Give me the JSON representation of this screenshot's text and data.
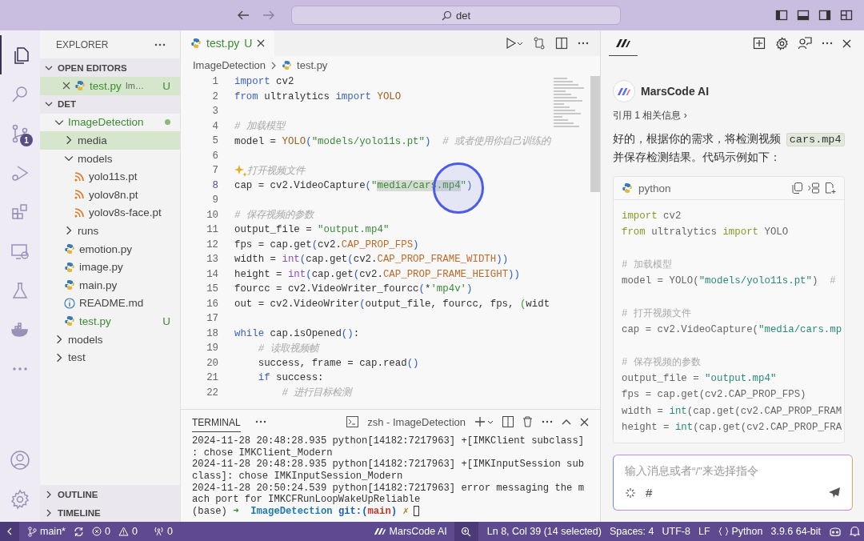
{
  "title_bar": {
    "search": "det"
  },
  "activity_bar": {
    "items": [
      {
        "kind": "files",
        "selected": true
      },
      {
        "kind": "search",
        "selected": false
      },
      {
        "kind": "source-control",
        "selected": false,
        "badge": "1"
      },
      {
        "kind": "debug",
        "selected": false
      },
      {
        "kind": "extensions",
        "selected": false
      },
      {
        "kind": "remote",
        "selected": false
      },
      {
        "kind": "testing",
        "selected": false
      },
      {
        "kind": "docker",
        "selected": false
      },
      {
        "kind": "more",
        "selected": false
      }
    ],
    "bottom": [
      {
        "kind": "account"
      },
      {
        "kind": "settings"
      }
    ]
  },
  "explorer": {
    "title": "EXPLORER",
    "open_editors": {
      "title": "OPEN EDITORS",
      "expanded": true,
      "items": [
        {
          "name": "test.py",
          "description": "Im…",
          "status": "U",
          "selected": true
        }
      ]
    },
    "folder": {
      "title": "DET",
      "expanded": true,
      "tree": [
        {
          "name": "ImageDetection",
          "kind": "folder",
          "expanded": true,
          "selected": false,
          "untracked": true,
          "children": [
            {
              "name": "media",
              "kind": "folder",
              "expanded": false,
              "selected": true,
              "untracked": false
            },
            {
              "name": "models",
              "kind": "folder",
              "expanded": true,
              "selected": false,
              "untracked": false,
              "children": [
                {
                  "name": "yolo11s.pt",
                  "kind": "model",
                  "selected": false,
                  "untracked": false
                },
                {
                  "name": "yolov8n.pt",
                  "kind": "model",
                  "selected": false,
                  "untracked": false
                },
                {
                  "name": "yolov8s-face.pt",
                  "kind": "model",
                  "selected": false,
                  "untracked": false
                }
              ]
            },
            {
              "name": "runs",
              "kind": "folder",
              "expanded": false,
              "selected": false,
              "untracked": false
            },
            {
              "name": "emotion.py",
              "kind": "python",
              "selected": false,
              "untracked": false
            },
            {
              "name": "image.py",
              "kind": "python",
              "selected": false,
              "untracked": false
            },
            {
              "name": "main.py",
              "kind": "python",
              "selected": false,
              "untracked": false
            },
            {
              "name": "README.md",
              "kind": "info",
              "selected": false,
              "untracked": false
            },
            {
              "name": "test.py",
              "kind": "python",
              "selected": false,
              "untracked": true,
              "status": "U"
            }
          ]
        },
        {
          "name": "models",
          "kind": "folder",
          "expanded": false,
          "selected": false,
          "untracked": false
        },
        {
          "name": "test",
          "kind": "folder",
          "expanded": false,
          "selected": false,
          "untracked": false
        }
      ]
    },
    "collapsed_sections": [
      {
        "title": "OUTLINE",
        "expanded": false
      },
      {
        "title": "TIMELINE",
        "expanded": false
      }
    ]
  },
  "editor": {
    "tabs": [
      {
        "label": "test.py",
        "status": "U",
        "selected": true
      }
    ],
    "breadcrumb": [
      "ImageDetection",
      "test.py"
    ],
    "lines": [
      {
        "number": "1",
        "current": false,
        "tokens": [
          {
            "text": "import",
            "kind": "kw"
          },
          {
            "text": " cv2",
            "kind": "plain"
          }
        ]
      },
      {
        "number": "2",
        "current": false,
        "tokens": [
          {
            "text": "from",
            "kind": "kw"
          },
          {
            "text": " ultralytics ",
            "kind": "plain"
          },
          {
            "text": "import",
            "kind": "kw"
          },
          {
            "text": " YOLO",
            "kind": "cls"
          }
        ]
      },
      {
        "number": "3",
        "current": false
      },
      {
        "number": "4",
        "current": false,
        "tokens": [
          {
            "text": "# 加载模型",
            "kind": "com"
          }
        ]
      },
      {
        "number": "5",
        "current": false,
        "tokens": [
          {
            "text": "model = ",
            "kind": "plain"
          },
          {
            "text": "YOLO",
            "kind": "cls"
          },
          {
            "text": "(",
            "kind": "punc"
          },
          {
            "text": "\"models/yolo11s.pt\"",
            "kind": "str"
          },
          {
            "text": ")",
            "kind": "punc"
          },
          {
            "text": "  # 或者使用你自己训练的",
            "kind": "com"
          }
        ]
      },
      {
        "number": "6",
        "current": false
      },
      {
        "number": "7",
        "current": false,
        "tokens": [
          {
            "kind": "sparkle"
          },
          {
            "text": "打开视频文件",
            "kind": "com"
          }
        ]
      },
      {
        "number": "8",
        "current": true,
        "tokens": [
          {
            "text": "cap = cv2.VideoCapture",
            "kind": "plain"
          },
          {
            "text": "(",
            "kind": "punc"
          },
          {
            "text": "\"",
            "kind": "str"
          },
          {
            "text": "media/cars.mp4",
            "kind": "sel"
          },
          {
            "text": "\"",
            "kind": "str"
          },
          {
            "text": ")",
            "kind": "punc"
          }
        ]
      },
      {
        "number": "9",
        "current": false
      },
      {
        "number": "10",
        "current": false,
        "tokens": [
          {
            "text": "# 保存视频的参数",
            "kind": "com"
          }
        ]
      },
      {
        "number": "11",
        "current": false,
        "tokens": [
          {
            "text": "output_file = ",
            "kind": "plain"
          },
          {
            "text": "\"output.mp4\"",
            "kind": "str"
          }
        ]
      },
      {
        "number": "12",
        "current": false,
        "tokens": [
          {
            "text": "fps = cap.get",
            "kind": "plain"
          },
          {
            "text": "(",
            "kind": "punc"
          },
          {
            "text": "cv2.",
            "kind": "plain"
          },
          {
            "text": "CAP_PROP_FPS",
            "kind": "const"
          },
          {
            "text": ")",
            "kind": "punc"
          }
        ]
      },
      {
        "number": "13",
        "current": false,
        "tokens": [
          {
            "text": "width = ",
            "kind": "plain"
          },
          {
            "text": "int",
            "kind": "builtin"
          },
          {
            "text": "(",
            "kind": "punc"
          },
          {
            "text": "cap.get",
            "kind": "plain"
          },
          {
            "text": "(",
            "kind": "punc"
          },
          {
            "text": "cv2.",
            "kind": "plain"
          },
          {
            "text": "CAP_PROP_FRAME_WIDTH",
            "kind": "const"
          },
          {
            "text": "))",
            "kind": "punc"
          }
        ]
      },
      {
        "number": "14",
        "current": false,
        "tokens": [
          {
            "text": "height = ",
            "kind": "plain"
          },
          {
            "text": "int",
            "kind": "builtin"
          },
          {
            "text": "(",
            "kind": "punc"
          },
          {
            "text": "cap.get",
            "kind": "plain"
          },
          {
            "text": "(",
            "kind": "punc"
          },
          {
            "text": "cv2.",
            "kind": "plain"
          },
          {
            "text": "CAP_PROP_FRAME_HEIGHT",
            "kind": "const"
          },
          {
            "text": "))",
            "kind": "punc"
          }
        ]
      },
      {
        "number": "15",
        "current": false,
        "tokens": [
          {
            "text": "fourcc = cv2.VideoWriter_fourcc",
            "kind": "plain"
          },
          {
            "text": "(",
            "kind": "punc"
          },
          {
            "text": "*",
            "kind": "plain"
          },
          {
            "text": "'mp4v'",
            "kind": "str"
          },
          {
            "text": ")",
            "kind": "punc"
          }
        ]
      },
      {
        "number": "16",
        "current": false,
        "tokens": [
          {
            "text": "out = cv2.VideoWriter",
            "kind": "plain"
          },
          {
            "text": "(",
            "kind": "punc"
          },
          {
            "text": "output_file, fourcc, fps, ",
            "kind": "plain"
          },
          {
            "text": "(",
            "kind": "punc2"
          },
          {
            "text": "widt",
            "kind": "plain"
          }
        ]
      },
      {
        "number": "17",
        "current": false
      },
      {
        "number": "18",
        "current": false,
        "tokens": [
          {
            "text": "while",
            "kind": "kw"
          },
          {
            "text": " cap.isOpened",
            "kind": "plain"
          },
          {
            "text": "()",
            "kind": "punc"
          },
          {
            "text": ":",
            "kind": "plain"
          }
        ]
      },
      {
        "number": "19",
        "current": false,
        "tokens": [
          {
            "text": "    # 读取视频帧",
            "kind": "com"
          }
        ]
      },
      {
        "number": "20",
        "current": false,
        "tokens": [
          {
            "text": "    success, frame = cap.read",
            "kind": "plain"
          },
          {
            "text": "()",
            "kind": "punc"
          }
        ]
      },
      {
        "number": "21",
        "current": false,
        "tokens": [
          {
            "text": "    if",
            "kind": "kw"
          },
          {
            "text": " success:",
            "kind": "plain"
          }
        ]
      },
      {
        "number": "22",
        "current": false,
        "tokens": [
          {
            "text": "        # 进行目标检测",
            "kind": "com"
          }
        ]
      }
    ]
  },
  "terminal": {
    "tab": "TERMINAL",
    "shell": "zsh - ImageDetection",
    "lines": [
      "2024-11-28 20:48:28.935 python[14182:7217963] +[IMKClient subclass]",
      ": chose IMKClient_Modern",
      "2024-11-28 20:48:28.935 python[14182:7217963] +[IMKInputSession sub",
      "class]: chose IMKInputSession_Modern",
      "2024-11-28 20:50:24.539 python[14182:7217963] error messaging the m",
      "ach port for IMKCFRunLoopWakeUpReliable"
    ],
    "prompt": [
      {
        "text": "(base) ",
        "kind": "plain"
      },
      {
        "text": "➜",
        "kind": "arrow"
      },
      {
        "text": "  ImageDetection",
        "kind": "dir"
      },
      {
        "text": " git:(",
        "kind": "git"
      },
      {
        "text": "main",
        "kind": "branch"
      },
      {
        "text": ")",
        "kind": "git"
      },
      {
        "text": " ✗",
        "kind": "dirty"
      }
    ]
  },
  "chat": {
    "name": "MarsCode AI",
    "references": "引用 1 相关信息 ›",
    "message": {
      "text_before": "好的，根据你的需求，将检测视频 ",
      "inline_code": "cars.mp4",
      "text_after": "并保存检测结果。代码示例如下："
    },
    "code_block": {
      "language": "python",
      "lines": [
        {
          "blank_before": false,
          "tokens": [
            {
              "text": "import",
              "kind": "kw"
            },
            {
              "text": " cv2",
              "kind": "plain"
            }
          ]
        },
        {
          "blank_before": false,
          "tokens": [
            {
              "text": "from",
              "kind": "kw"
            },
            {
              "text": " ultralytics ",
              "kind": "plain"
            },
            {
              "text": "import",
              "kind": "kw"
            },
            {
              "text": " YOLO",
              "kind": "plain"
            }
          ]
        },
        {
          "blank_before": true,
          "tokens": [
            {
              "text": "# 加载模型",
              "kind": "com"
            }
          ]
        },
        {
          "blank_before": false,
          "tokens": [
            {
              "text": "model = YOLO(",
              "kind": "plain"
            },
            {
              "text": "\"models/yolo11s.pt\"",
              "kind": "str"
            },
            {
              "text": ")  ",
              "kind": "plain"
            },
            {
              "text": "#",
              "kind": "com"
            }
          ]
        },
        {
          "blank_before": true,
          "tokens": [
            {
              "text": "# 打开视频文件",
              "kind": "com"
            }
          ]
        },
        {
          "blank_before": false,
          "tokens": [
            {
              "text": "cap = cv2.VideoCapture(",
              "kind": "plain"
            },
            {
              "text": "\"media/cars.mp",
              "kind": "str"
            }
          ]
        },
        {
          "blank_before": true,
          "tokens": [
            {
              "text": "# 保存视频的参数",
              "kind": "com"
            }
          ]
        },
        {
          "blank_before": false,
          "tokens": [
            {
              "text": "output_file = ",
              "kind": "plain"
            },
            {
              "text": "\"output.mp4\"",
              "kind": "str"
            }
          ]
        },
        {
          "blank_before": false,
          "tokens": [
            {
              "text": "fps = cap.get(cv2.CAP_PROP_FPS)",
              "kind": "plain"
            }
          ]
        },
        {
          "blank_before": false,
          "tokens": [
            {
              "text": "width = ",
              "kind": "plain"
            },
            {
              "text": "int",
              "kind": "builtin"
            },
            {
              "text": "(cap.get(cv2.CAP_PROP_FRAM",
              "kind": "plain"
            }
          ]
        },
        {
          "blank_before": false,
          "tokens": [
            {
              "text": "height = ",
              "kind": "plain"
            },
            {
              "text": "int",
              "kind": "builtin"
            },
            {
              "text": "(cap.get(cv2.CAP_PROP_FRA",
              "kind": "plain"
            }
          ]
        }
      ]
    },
    "input": {
      "placeholder": "输入消息或者“/”来选择指令",
      "hash": "#"
    }
  },
  "status_bar": {
    "items": [
      {
        "kind": "remote"
      },
      {
        "kind": "branch",
        "text": "main*"
      },
      {
        "kind": "sync"
      },
      {
        "kind": "errors",
        "text": "0"
      },
      {
        "kind": "warnings",
        "text": "0"
      },
      {
        "kind": "ports",
        "text": "0"
      },
      {
        "kind": "marscode",
        "text": "MarsCode AI"
      },
      {
        "kind": "zoom"
      },
      {
        "kind": "text",
        "text": "Ln 8, Col 39 (14 selected)"
      },
      {
        "kind": "text",
        "text": "Spaces: 4"
      },
      {
        "kind": "text",
        "text": "UTF-8"
      },
      {
        "kind": "text",
        "text": "LF"
      },
      {
        "kind": "language",
        "text": "Python"
      },
      {
        "kind": "text",
        "text": "3.9.6 64-bit"
      },
      {
        "kind": "copilot"
      },
      {
        "kind": "bell"
      }
    ]
  }
}
